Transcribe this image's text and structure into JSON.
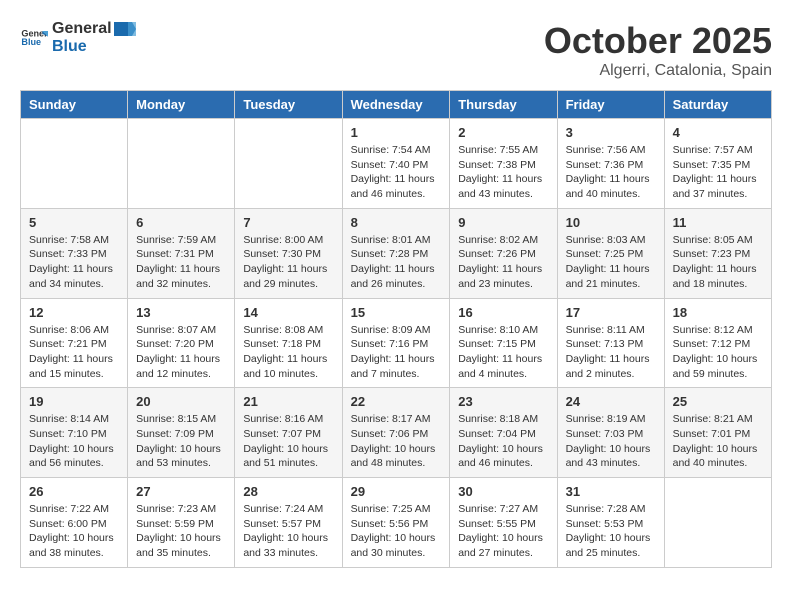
{
  "header": {
    "logo_general": "General",
    "logo_blue": "Blue",
    "month": "October 2025",
    "location": "Algerri, Catalonia, Spain"
  },
  "days_of_week": [
    "Sunday",
    "Monday",
    "Tuesday",
    "Wednesday",
    "Thursday",
    "Friday",
    "Saturday"
  ],
  "weeks": [
    [
      {
        "day": "",
        "info": ""
      },
      {
        "day": "",
        "info": ""
      },
      {
        "day": "",
        "info": ""
      },
      {
        "day": "1",
        "info": "Sunrise: 7:54 AM\nSunset: 7:40 PM\nDaylight: 11 hours and 46 minutes."
      },
      {
        "day": "2",
        "info": "Sunrise: 7:55 AM\nSunset: 7:38 PM\nDaylight: 11 hours and 43 minutes."
      },
      {
        "day": "3",
        "info": "Sunrise: 7:56 AM\nSunset: 7:36 PM\nDaylight: 11 hours and 40 minutes."
      },
      {
        "day": "4",
        "info": "Sunrise: 7:57 AM\nSunset: 7:35 PM\nDaylight: 11 hours and 37 minutes."
      }
    ],
    [
      {
        "day": "5",
        "info": "Sunrise: 7:58 AM\nSunset: 7:33 PM\nDaylight: 11 hours and 34 minutes."
      },
      {
        "day": "6",
        "info": "Sunrise: 7:59 AM\nSunset: 7:31 PM\nDaylight: 11 hours and 32 minutes."
      },
      {
        "day": "7",
        "info": "Sunrise: 8:00 AM\nSunset: 7:30 PM\nDaylight: 11 hours and 29 minutes."
      },
      {
        "day": "8",
        "info": "Sunrise: 8:01 AM\nSunset: 7:28 PM\nDaylight: 11 hours and 26 minutes."
      },
      {
        "day": "9",
        "info": "Sunrise: 8:02 AM\nSunset: 7:26 PM\nDaylight: 11 hours and 23 minutes."
      },
      {
        "day": "10",
        "info": "Sunrise: 8:03 AM\nSunset: 7:25 PM\nDaylight: 11 hours and 21 minutes."
      },
      {
        "day": "11",
        "info": "Sunrise: 8:05 AM\nSunset: 7:23 PM\nDaylight: 11 hours and 18 minutes."
      }
    ],
    [
      {
        "day": "12",
        "info": "Sunrise: 8:06 AM\nSunset: 7:21 PM\nDaylight: 11 hours and 15 minutes."
      },
      {
        "day": "13",
        "info": "Sunrise: 8:07 AM\nSunset: 7:20 PM\nDaylight: 11 hours and 12 minutes."
      },
      {
        "day": "14",
        "info": "Sunrise: 8:08 AM\nSunset: 7:18 PM\nDaylight: 11 hours and 10 minutes."
      },
      {
        "day": "15",
        "info": "Sunrise: 8:09 AM\nSunset: 7:16 PM\nDaylight: 11 hours and 7 minutes."
      },
      {
        "day": "16",
        "info": "Sunrise: 8:10 AM\nSunset: 7:15 PM\nDaylight: 11 hours and 4 minutes."
      },
      {
        "day": "17",
        "info": "Sunrise: 8:11 AM\nSunset: 7:13 PM\nDaylight: 11 hours and 2 minutes."
      },
      {
        "day": "18",
        "info": "Sunrise: 8:12 AM\nSunset: 7:12 PM\nDaylight: 10 hours and 59 minutes."
      }
    ],
    [
      {
        "day": "19",
        "info": "Sunrise: 8:14 AM\nSunset: 7:10 PM\nDaylight: 10 hours and 56 minutes."
      },
      {
        "day": "20",
        "info": "Sunrise: 8:15 AM\nSunset: 7:09 PM\nDaylight: 10 hours and 53 minutes."
      },
      {
        "day": "21",
        "info": "Sunrise: 8:16 AM\nSunset: 7:07 PM\nDaylight: 10 hours and 51 minutes."
      },
      {
        "day": "22",
        "info": "Sunrise: 8:17 AM\nSunset: 7:06 PM\nDaylight: 10 hours and 48 minutes."
      },
      {
        "day": "23",
        "info": "Sunrise: 8:18 AM\nSunset: 7:04 PM\nDaylight: 10 hours and 46 minutes."
      },
      {
        "day": "24",
        "info": "Sunrise: 8:19 AM\nSunset: 7:03 PM\nDaylight: 10 hours and 43 minutes."
      },
      {
        "day": "25",
        "info": "Sunrise: 8:21 AM\nSunset: 7:01 PM\nDaylight: 10 hours and 40 minutes."
      }
    ],
    [
      {
        "day": "26",
        "info": "Sunrise: 7:22 AM\nSunset: 6:00 PM\nDaylight: 10 hours and 38 minutes."
      },
      {
        "day": "27",
        "info": "Sunrise: 7:23 AM\nSunset: 5:59 PM\nDaylight: 10 hours and 35 minutes."
      },
      {
        "day": "28",
        "info": "Sunrise: 7:24 AM\nSunset: 5:57 PM\nDaylight: 10 hours and 33 minutes."
      },
      {
        "day": "29",
        "info": "Sunrise: 7:25 AM\nSunset: 5:56 PM\nDaylight: 10 hours and 30 minutes."
      },
      {
        "day": "30",
        "info": "Sunrise: 7:27 AM\nSunset: 5:55 PM\nDaylight: 10 hours and 27 minutes."
      },
      {
        "day": "31",
        "info": "Sunrise: 7:28 AM\nSunset: 5:53 PM\nDaylight: 10 hours and 25 minutes."
      },
      {
        "day": "",
        "info": ""
      }
    ]
  ]
}
